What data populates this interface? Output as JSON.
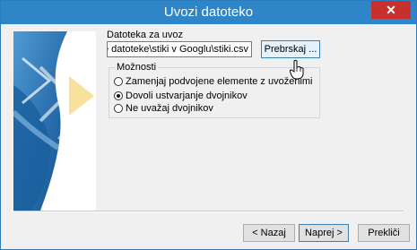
{
  "window": {
    "title": "Uvozi datoteko",
    "close_glyph": "✕"
  },
  "file": {
    "label": "Datoteka za uvoz",
    "value": "rčne datoteke\\stiki v Googlu\\stiki.csv",
    "browse_label": "Prebrskaj ..."
  },
  "options": {
    "title": "Možnosti",
    "items": [
      {
        "label": "Zamenjaj podvojene elemente z uvoženimi",
        "selected": false
      },
      {
        "label": "Dovoli ustvarjanje dvojnikov",
        "selected": true
      },
      {
        "label": "Ne uvažaj dvojnikov",
        "selected": false
      }
    ]
  },
  "buttons": {
    "back": "< Nazaj",
    "next": "Naprej >",
    "cancel": "Prekliči"
  },
  "colors": {
    "title_bar": "#2e86c9",
    "close_button": "#c7302c",
    "wizard_dark": "#1a5f9e",
    "wizard_light": "#8fc3ea"
  },
  "icons": {
    "cursor": "hand-pointer-icon",
    "close": "close-icon"
  }
}
